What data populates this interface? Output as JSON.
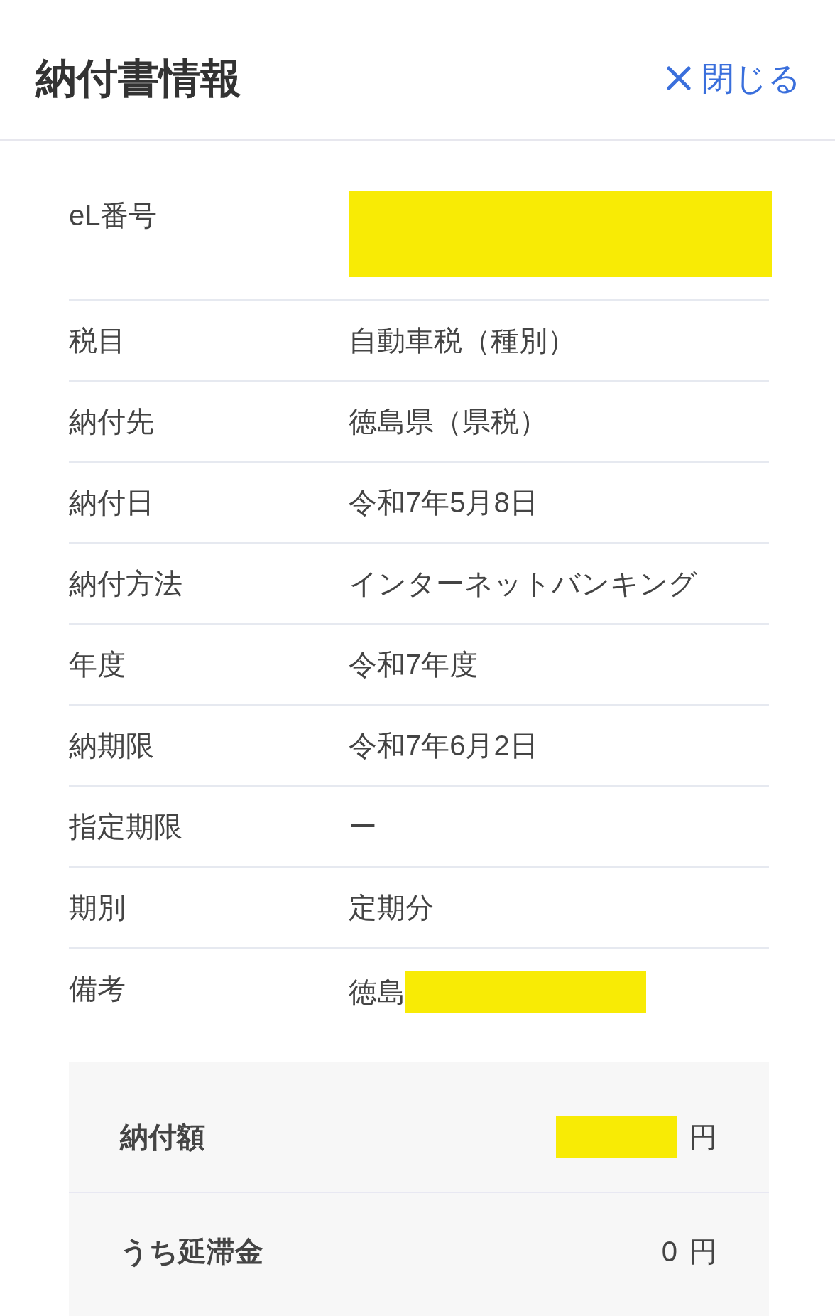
{
  "header": {
    "title": "納付書情報",
    "close_label": "閉じる"
  },
  "fields": [
    {
      "label": "eL番号",
      "redacted": true
    },
    {
      "label": "税目",
      "value": "自動車税（種別）"
    },
    {
      "label": "納付先",
      "value": "徳島県（県税）"
    },
    {
      "label": "納付日",
      "value": "令和7年5月8日"
    },
    {
      "label": "納付方法",
      "value": "インターネットバンキング"
    },
    {
      "label": "年度",
      "value": "令和7年度"
    },
    {
      "label": "納期限",
      "value": "令和7年6月2日"
    },
    {
      "label": "指定期限",
      "value": "ー"
    },
    {
      "label": "期別",
      "value": "定期分"
    },
    {
      "label": "備考",
      "value": "徳島",
      "redacted": true
    }
  ],
  "summary": [
    {
      "label": "納付額",
      "redacted": true,
      "unit": "円"
    },
    {
      "label": "うち延滞金",
      "value": "0",
      "unit": "円"
    }
  ]
}
